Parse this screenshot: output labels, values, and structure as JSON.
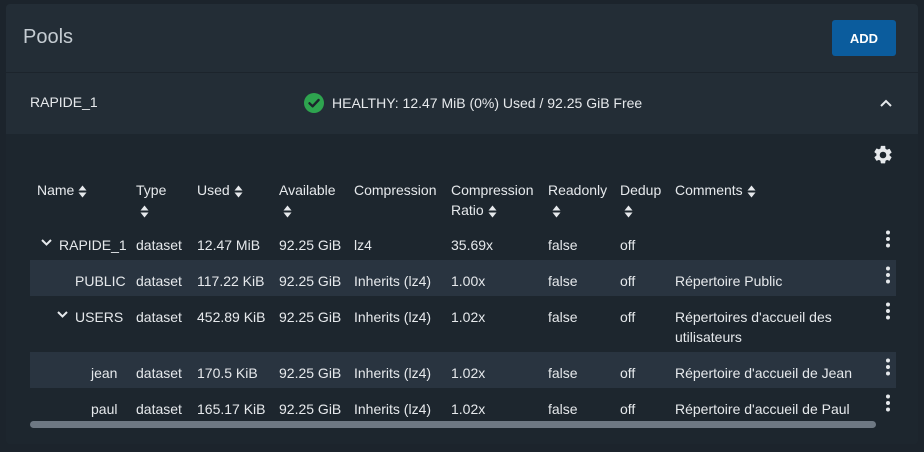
{
  "page": {
    "title": "Pools"
  },
  "toolbar": {
    "add_label": "ADD"
  },
  "pool": {
    "name": "RAPIDE_1",
    "status": "HEALTHY: 12.47 MiB (0%) Used / 92.25 GiB Free",
    "status_color": "#2ea44f"
  },
  "columns": {
    "name": "Name",
    "type": "Type",
    "used": "Used",
    "available": "Available",
    "compression": "Compression",
    "ratio_line1": "Compression",
    "ratio_line2": "Ratio",
    "readonly": "Readonly",
    "dedup": "Dedup",
    "comments": "Comments"
  },
  "rows": [
    {
      "name": "RAPIDE_1",
      "type": "dataset",
      "used": "12.47 MiB",
      "available": "92.25 GiB",
      "compression": "lz4",
      "ratio": "35.69x",
      "readonly": "false",
      "dedup": "off",
      "comments": ""
    },
    {
      "name": "PUBLIC",
      "type": "dataset",
      "used": "117.22 KiB",
      "available": "92.25 GiB",
      "compression": "Inherits (lz4)",
      "ratio": "1.00x",
      "readonly": "false",
      "dedup": "off",
      "comments": "Répertoire Public"
    },
    {
      "name": "USERS",
      "type": "dataset",
      "used": "452.89 KiB",
      "available": "92.25 GiB",
      "compression": "Inherits (lz4)",
      "ratio": "1.02x",
      "readonly": "false",
      "dedup": "off",
      "comments": "Répertoires d'accueil des utilisateurs"
    },
    {
      "name": "jean",
      "type": "dataset",
      "used": "170.5 KiB",
      "available": "92.25 GiB",
      "compression": "Inherits (lz4)",
      "ratio": "1.02x",
      "readonly": "false",
      "dedup": "off",
      "comments": "Répertoire d'accueil de Jean"
    },
    {
      "name": "paul",
      "type": "dataset",
      "used": "165.17 KiB",
      "available": "92.25 GiB",
      "compression": "Inherits (lz4)",
      "ratio": "1.02x",
      "readonly": "false",
      "dedup": "off",
      "comments": "Répertoire d'accueil de Paul"
    }
  ],
  "colors": {
    "accent": "#0b5c9d",
    "healthy": "#2ea44f"
  }
}
